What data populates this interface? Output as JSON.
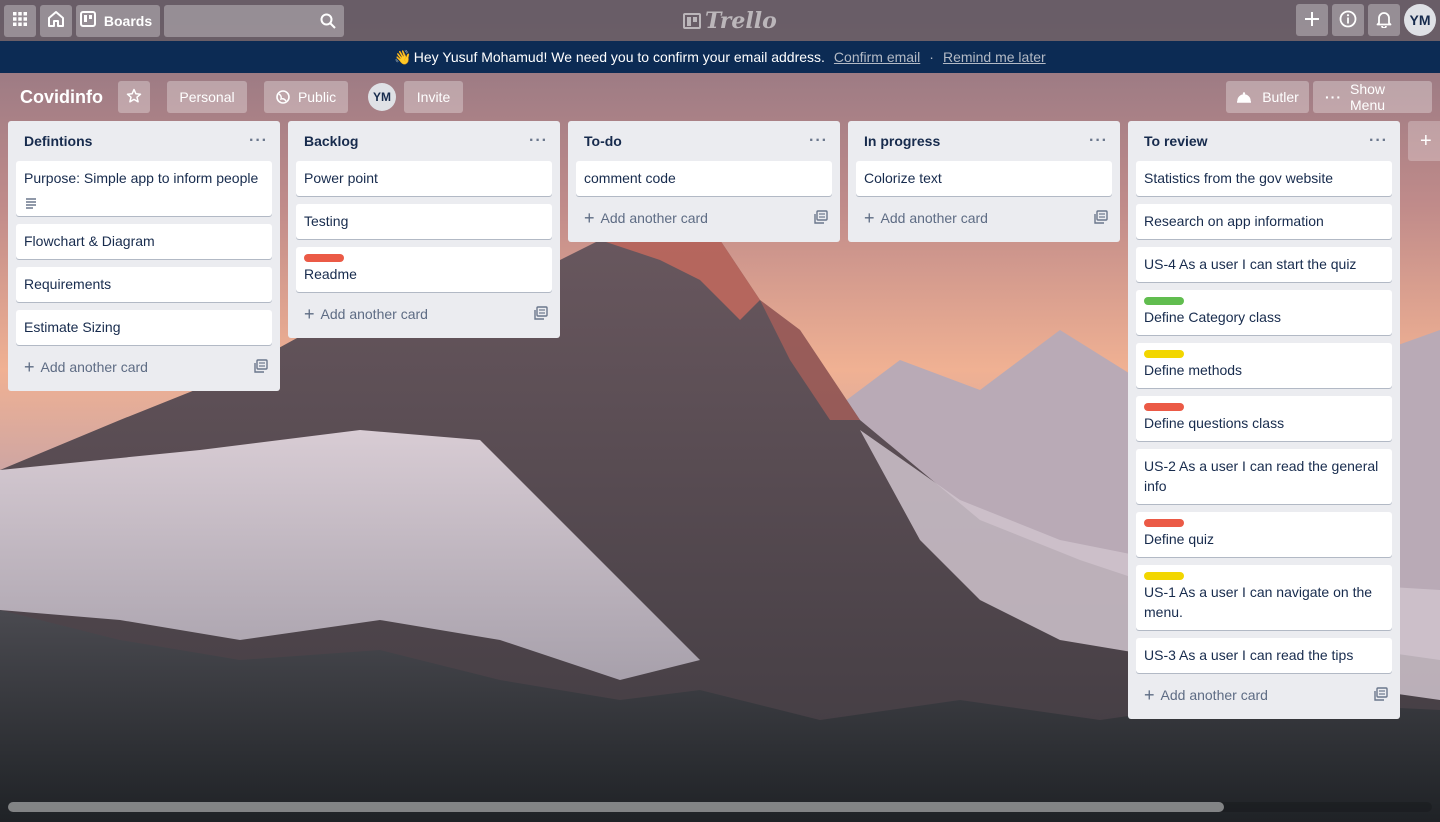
{
  "topbar": {
    "boards_label": "Boards",
    "logo_text": "Trello",
    "avatar_initials": "YM"
  },
  "banner": {
    "message": "Hey Yusuf Mohamud! We need you to confirm your email address.",
    "confirm_link": "Confirm email",
    "separator": "·",
    "remind_link": "Remind me later"
  },
  "board": {
    "title": "Covidinfo",
    "personal_label": "Personal",
    "public_label": "Public",
    "member_initials": "YM",
    "invite_label": "Invite",
    "butler_label": "Butler",
    "show_menu_label": "Show Menu"
  },
  "add_card_label": "Add another card",
  "lists": [
    {
      "title": "Defintions",
      "cards": [
        {
          "text": "Purpose: Simple app to inform people",
          "has_description": true
        },
        {
          "text": "Flowchart & Diagram"
        },
        {
          "text": "Requirements"
        },
        {
          "text": "Estimate Sizing"
        }
      ]
    },
    {
      "title": "Backlog",
      "cards": [
        {
          "text": "Power point"
        },
        {
          "text": "Testing"
        },
        {
          "text": "Readme",
          "label_color": "#eb5a46"
        }
      ]
    },
    {
      "title": "To-do",
      "cards": [
        {
          "text": "comment code"
        }
      ]
    },
    {
      "title": "In progress",
      "cards": [
        {
          "text": "Colorize text"
        }
      ]
    },
    {
      "title": "To review",
      "cards": [
        {
          "text": "Statistics from the gov website"
        },
        {
          "text": "Research on app information"
        },
        {
          "text": "US-4 As a user I can start the quiz"
        },
        {
          "text": "Define Category class",
          "label_color": "#61bd4f"
        },
        {
          "text": "Define methods",
          "label_color": "#f2d600"
        },
        {
          "text": "Define questions class",
          "label_color": "#eb5a46"
        },
        {
          "text": "US-2 As a user I can read the general info"
        },
        {
          "text": "Define quiz",
          "label_color": "#eb5a46"
        },
        {
          "text": "US-1 As a user I can navigate on the menu.",
          "label_color": "#f2d600"
        },
        {
          "text": "US-3 As a user I can read the tips"
        }
      ]
    }
  ]
}
